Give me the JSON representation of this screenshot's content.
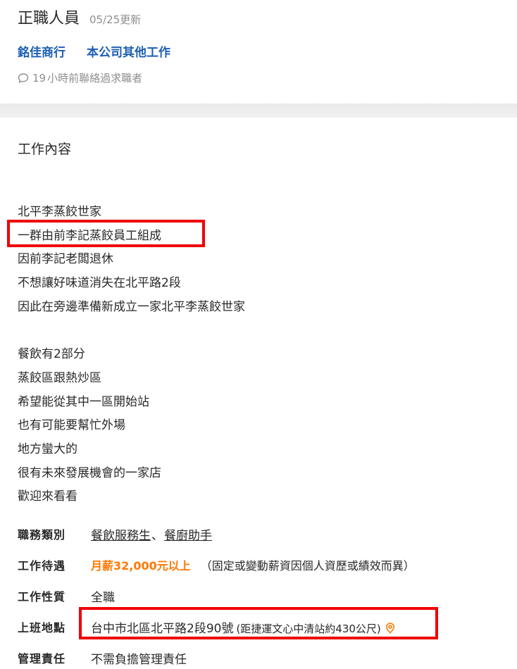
{
  "header": {
    "job_title": "正職人員",
    "update_date": "05/25更新",
    "company_links": [
      "銘佳商行",
      "本公司其他工作"
    ],
    "contact_count": "19",
    "contact_text": "小時前聯絡過求職者"
  },
  "content": {
    "section_title": "工作內容",
    "lines": [
      "北平李蒸餃世家",
      "一群由前李記蒸餃員工組成",
      "因前李記老闆退休",
      "不想讓好味道消失在北平路2段",
      "因此在旁邊準備新成立一家北平李蒸餃世家",
      "",
      "餐飲有2部分",
      "蒸餃區跟熱炒區",
      "希望能從其中一區開始站",
      "也有可能要幫忙外場",
      "地方蠻大的",
      "很有未來發展機會的一家店",
      "歡迎來看看"
    ]
  },
  "info": {
    "category_label": "職務類別",
    "categories": [
      "餐飲服務生",
      "餐廚助手"
    ],
    "category_sep": "、",
    "salary_label": "工作待遇",
    "salary_value": "月薪32,000元以上",
    "salary_note": "（固定或變動薪資因個人資歷或績效而異）",
    "nature_label": "工作性質",
    "nature_value": "全職",
    "location_label": "上班地點",
    "address": "台中市北區北平路2段90號",
    "address_note": "(距捷運文心中清站約430公尺)",
    "management_label": "管理責任",
    "management_value": "不需負擔管理責任"
  },
  "colors": {
    "link_blue": "#1c5fb3",
    "salary_orange": "#ff7800",
    "highlight_red": "#f00000",
    "muted_gray": "#8e8e8e"
  },
  "icons": {
    "contact": "chat-bubble-icon",
    "location": "map-pin-icon"
  }
}
